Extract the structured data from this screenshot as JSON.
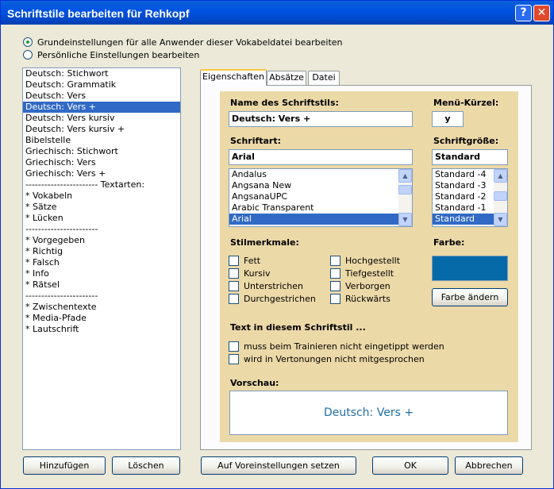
{
  "window": {
    "title": "Schriftstile bearbeiten für Rehkopf",
    "help_glyph": "?",
    "close_glyph": "✕"
  },
  "scope": {
    "option_all": "Grundeinstellungen für alle Anwender dieser Vokabeldatei bearbeiten",
    "option_personal": "Persönliche Einstellungen bearbeiten",
    "selected": "option_all"
  },
  "styles_list": {
    "items": [
      "Deutsch: Stichwort",
      "Deutsch: Grammatik",
      "Deutsch: Vers",
      "Deutsch: Vers +",
      "Deutsch: Vers kursiv",
      "Deutsch: Vers kursiv +",
      "Bibelstelle",
      "Griechisch: Stichwort",
      "Griechisch: Vers",
      "Griechisch: Vers +",
      "----------------------- Textarten:",
      "* Vokabeln",
      "* Sätze",
      "* Lücken",
      "-----------------------",
      "* Vorgegeben",
      "* Richtig",
      "* Falsch",
      "* Info",
      "* Rätsel",
      "-----------------------",
      "* Zwischentexte",
      "* Media-Pfade",
      "* Lautschrift"
    ],
    "selected_index": 3
  },
  "tabs": [
    "Eigenschaften",
    "Absätze",
    "Datei"
  ],
  "properties": {
    "style_name_label": "Name des Schriftstils:",
    "style_name_value": "Deutsch: Vers +",
    "shortcut_label": "Menü-Kürzel:",
    "shortcut_value": "y",
    "font_label": "Schriftart:",
    "font_value": "Arial",
    "font_options": [
      "Andalus",
      "Angsana New",
      "AngsanaUPC",
      "Arabic Transparent",
      "Arial"
    ],
    "font_selected": 4,
    "size_label": "Schriftgröße:",
    "size_value": "Standard",
    "size_options": [
      "Standard -4",
      "Standard -3",
      "Standard -2",
      "Standard -1",
      "Standard"
    ],
    "size_selected": 4,
    "features_label": "Stilmerkmale:",
    "features_left": [
      "Fett",
      "Kursiv",
      "Unterstrichen",
      "Durchgestrichen"
    ],
    "features_right": [
      "Hochgestellt",
      "Tiefgestellt",
      "Verborgen",
      "Rückwärts"
    ],
    "color_label": "Farbe:",
    "color_value": "#0669a8",
    "change_color_button": "Farbe ändern",
    "text_in_style_label": "Text in diesem Schriftstil ...",
    "option_no_typing": "muss beim Trainieren nicht eingetippt werden",
    "option_not_spoken": "wird in Vertonungen nicht mitgesprochen",
    "preview_label": "Vorschau:",
    "preview_text": "Deutsch: Vers +"
  },
  "buttons": {
    "add": "Hinzufügen",
    "delete": "Löschen",
    "reset": "Auf Voreinstellungen setzen",
    "ok": "OK",
    "cancel": "Abbrechen"
  }
}
